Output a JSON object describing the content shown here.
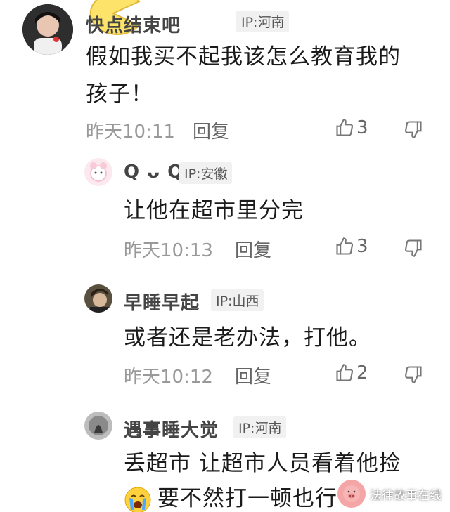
{
  "comments": [
    {
      "username": "快点结束吧",
      "ip": "IP:河南",
      "text_line1": "假如我买不起我该怎么教育我的",
      "text_line2": "孩子！",
      "time": "昨天10:11",
      "reply": "回复",
      "likes": "3"
    },
    {
      "username": "Q ᴗ Q",
      "ip": "IP:安徽",
      "text": "让他在超市里分完",
      "time": "昨天10:13",
      "reply": "回复",
      "likes": "3"
    },
    {
      "username": "早睡早起",
      "ip": "IP:山西",
      "text": "或者还是老办法，打他。",
      "time": "昨天10:12",
      "reply": "回复",
      "likes": "2"
    },
    {
      "username": "遇事睡大觉",
      "ip": "IP:河南",
      "text_line1": "丢超市 让超市人员看着他捡",
      "text_line2": "要不然打一顿也行",
      "emoji": "crying-emoji"
    }
  ],
  "watermark": {
    "text": "法律故事在线",
    "logo": "pig-logo"
  },
  "colors": {
    "text": "#1b1b1b",
    "username": "#444444",
    "meta": "#999999",
    "ip_bg": "#f1f1f1"
  }
}
